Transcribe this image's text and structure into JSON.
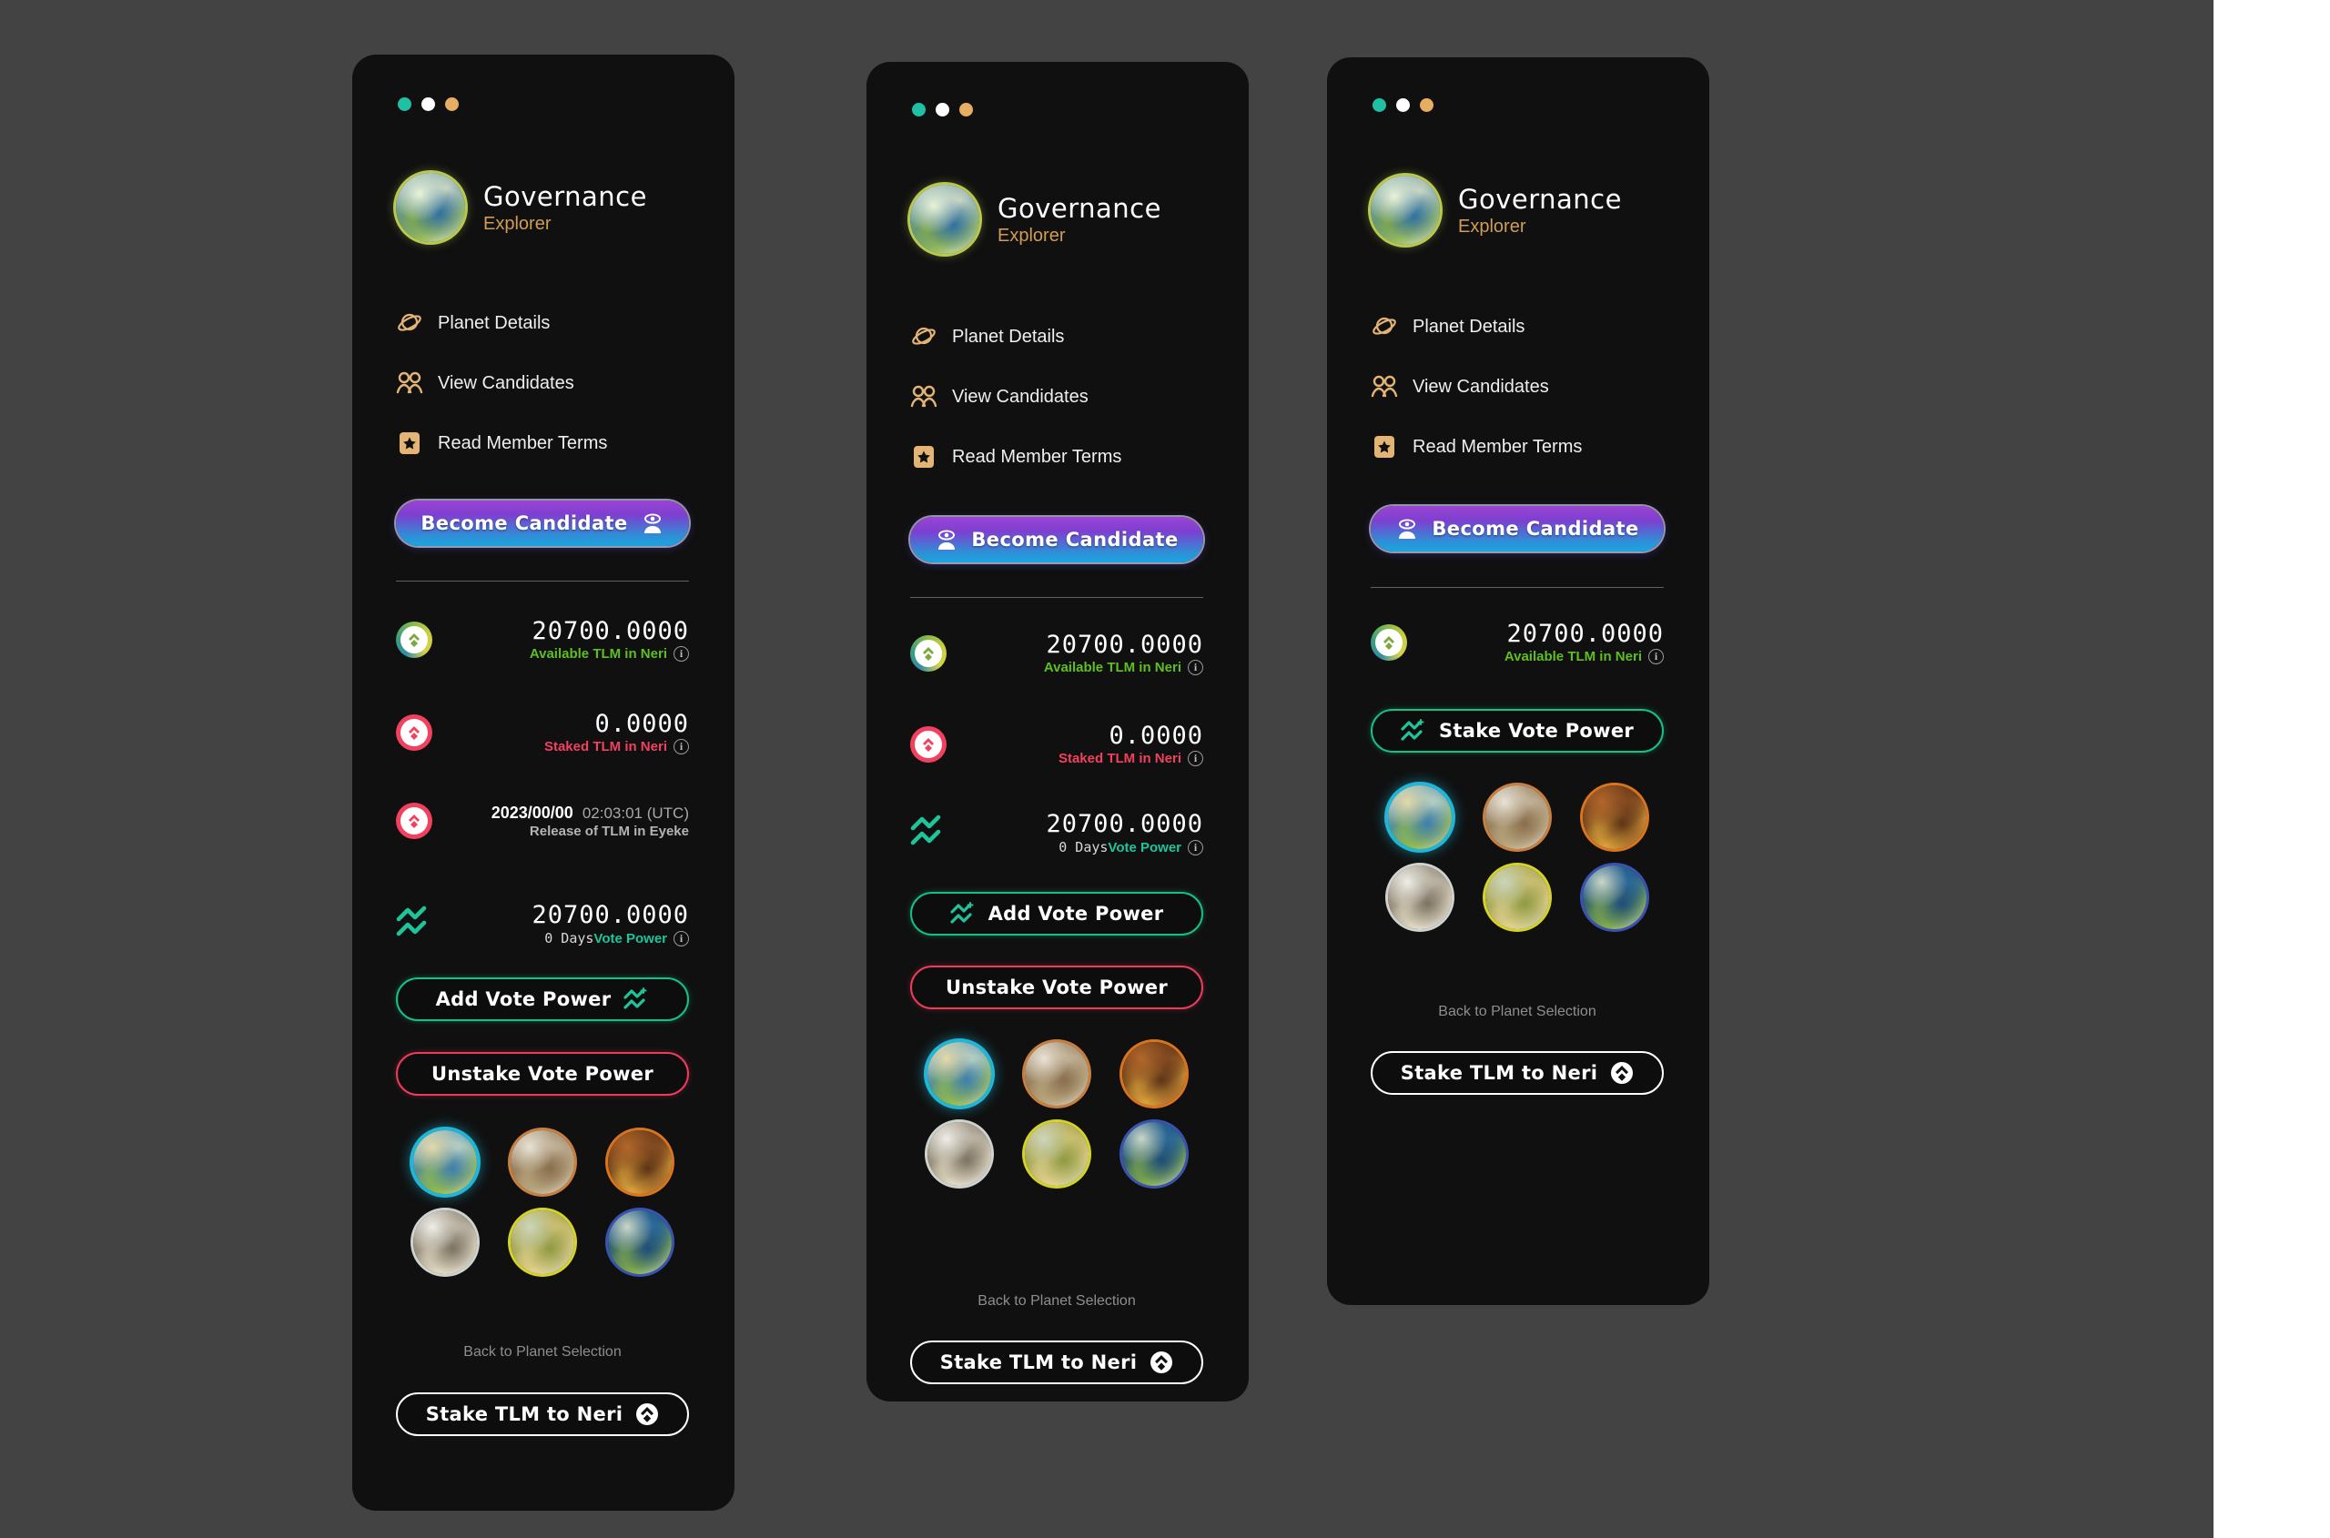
{
  "background": {
    "canvas": "#ffffff",
    "backdrop": "#434343"
  },
  "colors": {
    "panel_bg": "#101010",
    "accent_amber": "#cf9d55",
    "accent_green": "#5fbf20",
    "accent_red": "#f2415f",
    "accent_teal": "#1fc49a",
    "dot_teal": "#1fc0a4",
    "dot_white": "#ffffff",
    "dot_amber": "#e7ae63",
    "candidate_gradient_from": "#9b45d4",
    "candidate_gradient_to": "#19a5e0"
  },
  "window_dots": [
    {
      "name": "dot-teal",
      "color": "#1fc0a4"
    },
    {
      "name": "dot-white",
      "color": "#ffffff"
    },
    {
      "name": "dot-amber",
      "color": "#e7ae63"
    }
  ],
  "header": {
    "title": "Governance",
    "subtitle": "Explorer",
    "avatar_icon": "planet-neri-avatar"
  },
  "nav": {
    "items": [
      {
        "label": "Planet Details",
        "icon": "saturn-planet-icon"
      },
      {
        "label": "View Candidates",
        "icon": "two-people-icon"
      },
      {
        "label": "Read Member Terms",
        "icon": "star-badge-icon"
      }
    ]
  },
  "become_candidate": {
    "label": "Become Candidate",
    "icon": "candidate-eye-person-icon"
  },
  "stats": {
    "available": {
      "value": "20700.0000",
      "label": "Available TLM in Neri",
      "icon": "tlm-token-available-icon",
      "info": "i"
    },
    "staked": {
      "value": "0.0000",
      "label": "Staked TLM in Neri",
      "icon": "tlm-token-staked-icon",
      "info": "i"
    },
    "release": {
      "date": "2023/00/00",
      "time": "02:03:01 (UTC)",
      "label": "Release of TLM in Eyeke",
      "icon": "tlm-token-release-icon"
    },
    "vote_power": {
      "value": "20700.0000",
      "days": "0 Days",
      "label": "Vote Power",
      "icon": "vote-power-chart-icon",
      "info": "i"
    }
  },
  "actions": {
    "add_vote_power": {
      "label": "Add Vote Power",
      "icon": "vote-power-plus-icon"
    },
    "unstake_vote_power": {
      "label": "Unstake Vote Power"
    },
    "stake_vote_power": {
      "label": "Stake Vote Power",
      "icon": "vote-power-plus-icon"
    },
    "stake_tlm": {
      "label": "Stake TLM to Neri",
      "icon": "tlm-token-icon"
    }
  },
  "back_link": {
    "label": "Back to Planet Selection"
  },
  "planets": [
    {
      "name": "planet-neri",
      "selected": true,
      "ring": "#1fb6d8",
      "c1": "#cfe0c8",
      "c2": "#3f7fae",
      "c3": "#8fb84f",
      "c4": "#e4d9a8"
    },
    {
      "name": "planet-kavian",
      "selected": false,
      "ring": "#c97f3f",
      "c1": "#cdbfa6",
      "c2": "#8a6f4e",
      "c3": "#b9a77f",
      "c4": "#e8e3d6"
    },
    {
      "name": "planet-magor",
      "selected": false,
      "ring": "#d9741f",
      "c1": "#8a4e22",
      "c2": "#5e3416",
      "c3": "#d9a03a",
      "c4": "#b3672a"
    },
    {
      "name": "planet-eyeke",
      "selected": false,
      "ring": "#cfd3cf",
      "c1": "#c9c2b2",
      "c2": "#7d7363",
      "c3": "#ddd4bd",
      "c4": "#efeee8"
    },
    {
      "name": "planet-veles",
      "selected": false,
      "ring": "#d4d428",
      "c1": "#d8c579",
      "c2": "#8f9a43",
      "c3": "#e0cf8c",
      "c4": "#cdd5bb"
    },
    {
      "name": "planet-naron",
      "selected": false,
      "ring": "#3b52b0",
      "c1": "#2f6fa0",
      "c2": "#1d4d7a",
      "c3": "#7fa84a",
      "c4": "#cbd8c6"
    }
  ],
  "panels": [
    {
      "id": "panel-one",
      "has_release_row": true,
      "vote_power_separate_row": true,
      "vote_buttons": [
        "add",
        "unstake"
      ],
      "icon_side": "right"
    },
    {
      "id": "panel-two",
      "has_release_row": false,
      "vote_power_separate_row": true,
      "vote_buttons": [
        "add",
        "unstake"
      ],
      "icon_side": "left"
    },
    {
      "id": "panel-three",
      "has_release_row": false,
      "vote_power_separate_row": false,
      "vote_buttons": [
        "stake"
      ],
      "icon_side": "left"
    }
  ]
}
